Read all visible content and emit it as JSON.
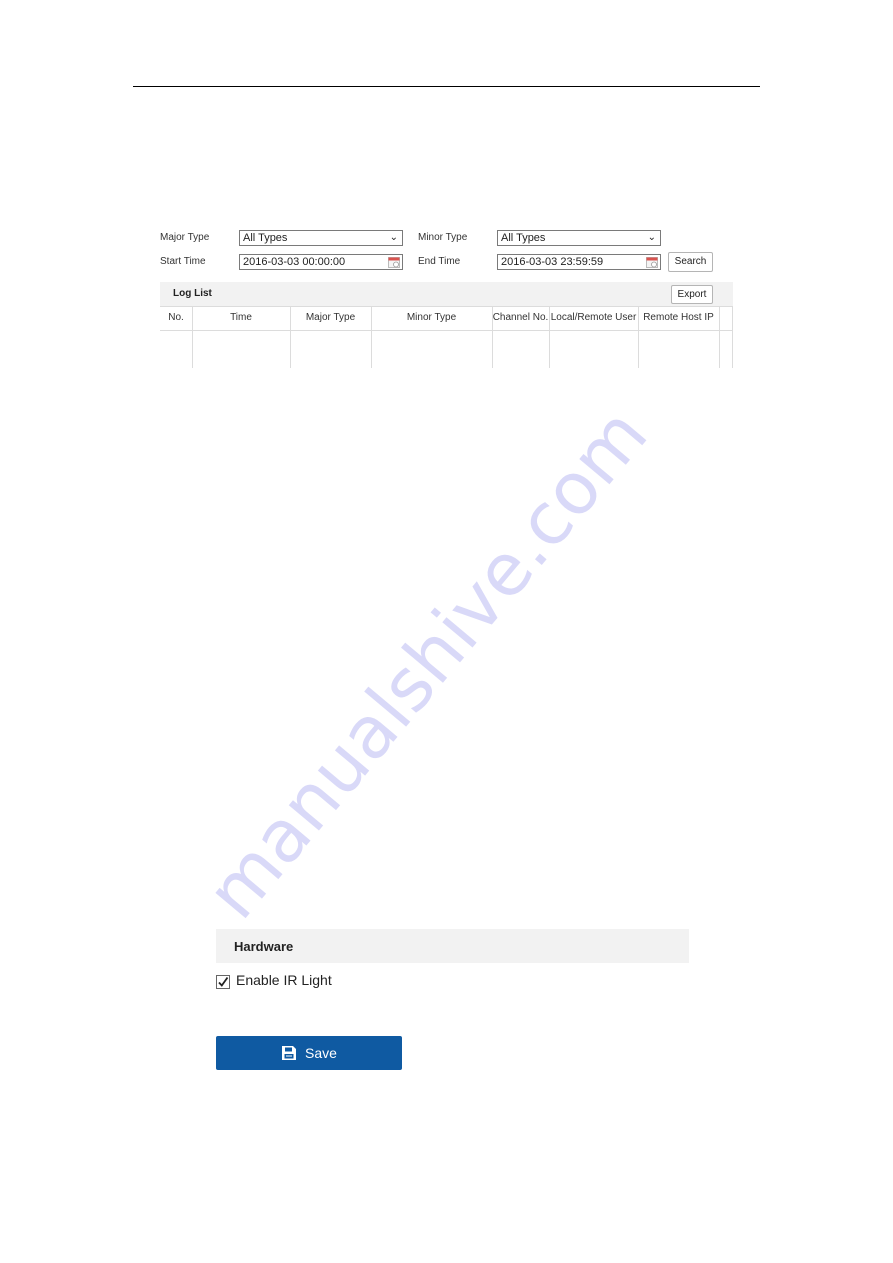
{
  "log_search": {
    "major_type_label": "Major Type",
    "major_type_value": "All Types",
    "minor_type_label": "Minor Type",
    "minor_type_value": "All Types",
    "start_time_label": "Start Time",
    "start_time_value": "2016-03-03 00:00:00",
    "end_time_label": "End Time",
    "end_time_value": "2016-03-03 23:59:59",
    "search_label": "Search"
  },
  "log_list": {
    "title": "Log List",
    "export_label": "Export",
    "columns": [
      "No.",
      "Time",
      "Major Type",
      "Minor Type",
      "Channel No.",
      "Local/Remote User",
      "Remote Host IP"
    ],
    "rows": []
  },
  "hardware": {
    "title": "Hardware",
    "enable_ir_label": "Enable IR Light",
    "enable_ir_checked": true,
    "save_label": "Save"
  },
  "watermark": "manualshive.com",
  "colors": {
    "save_button": "#0f5aa2",
    "panel_header": "#f2f2f2"
  }
}
